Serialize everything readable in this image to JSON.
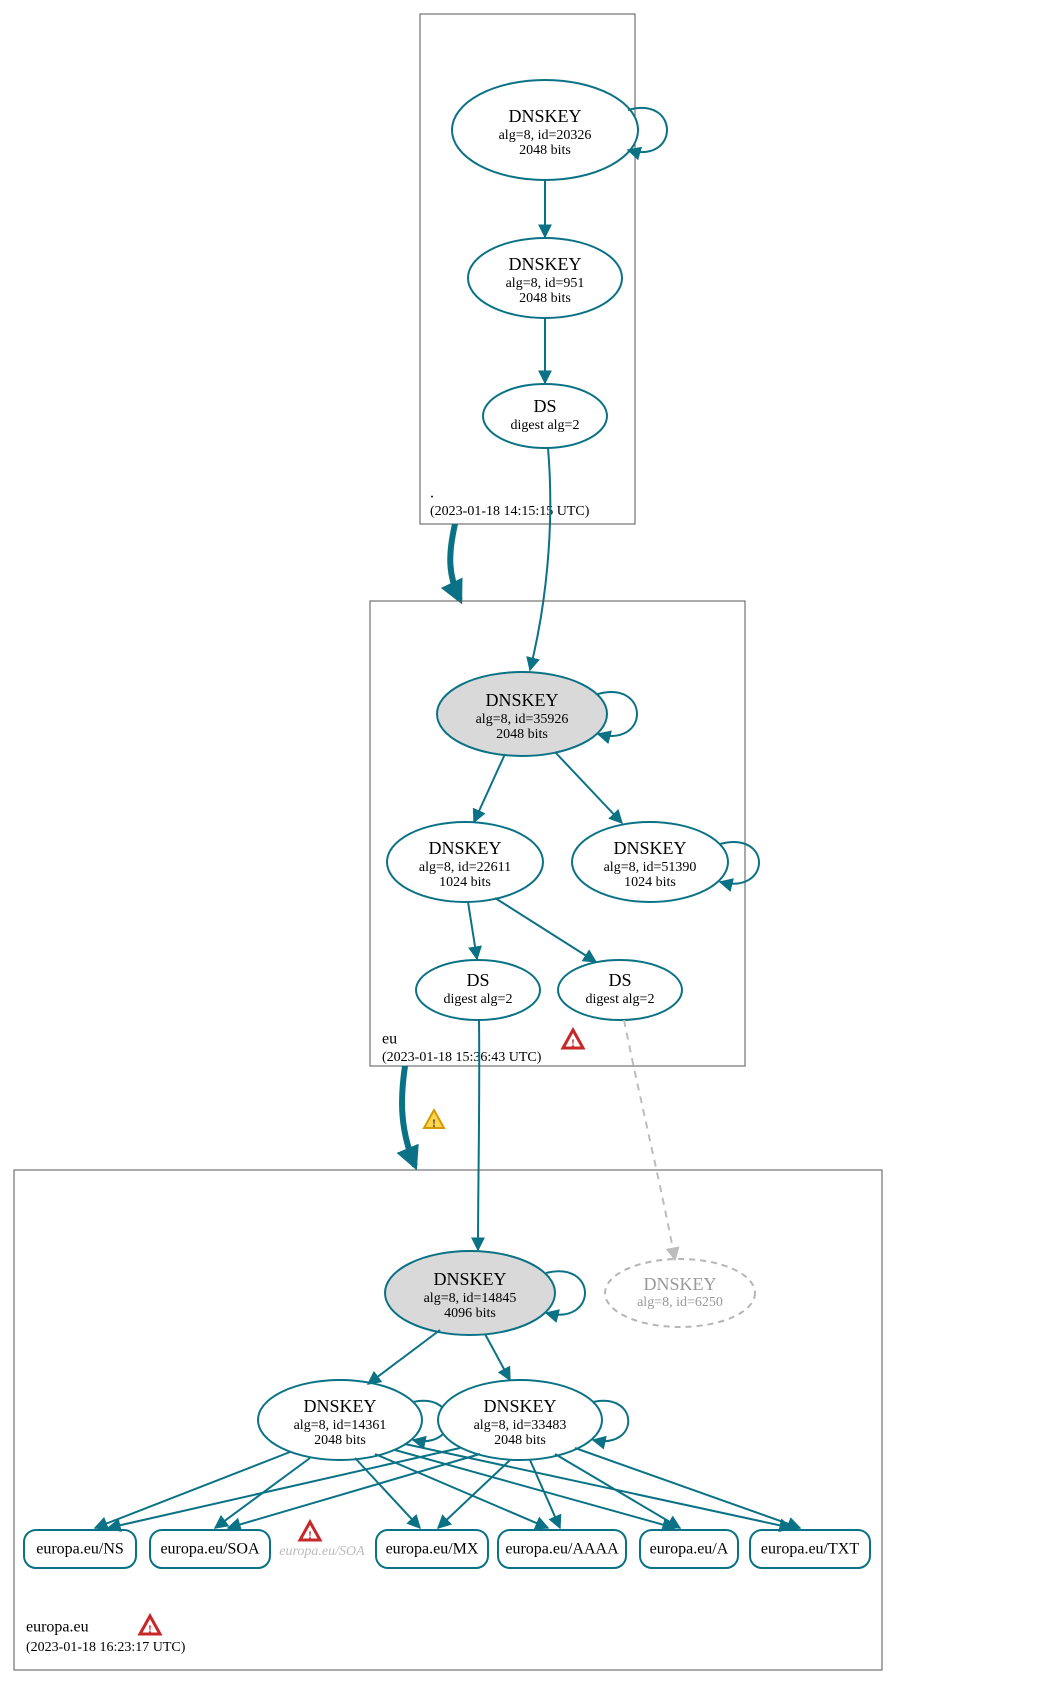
{
  "zones": {
    "root": {
      "label": ".",
      "timestamp": "(2023-01-18 14:15:15 UTC)",
      "nodes": {
        "ksk": {
          "title": "DNSKEY",
          "line1": "alg=8, id=20326",
          "line2": "2048 bits"
        },
        "zsk": {
          "title": "DNSKEY",
          "line1": "alg=8, id=951",
          "line2": "2048 bits"
        },
        "ds": {
          "title": "DS",
          "line1": "digest alg=2"
        }
      }
    },
    "eu": {
      "label": "eu",
      "timestamp": "(2023-01-18 15:36:43 UTC)",
      "nodes": {
        "ksk": {
          "title": "DNSKEY",
          "line1": "alg=8, id=35926",
          "line2": "2048 bits"
        },
        "zsk1": {
          "title": "DNSKEY",
          "line1": "alg=8, id=22611",
          "line2": "1024 bits"
        },
        "zsk2": {
          "title": "DNSKEY",
          "line1": "alg=8, id=51390",
          "line2": "1024 bits"
        },
        "ds1": {
          "title": "DS",
          "line1": "digest alg=2"
        },
        "ds2": {
          "title": "DS",
          "line1": "digest alg=2"
        }
      }
    },
    "europa": {
      "label": "europa.eu",
      "timestamp": "(2023-01-18 16:23:17 UTC)",
      "nodes": {
        "ksk": {
          "title": "DNSKEY",
          "line1": "alg=8, id=14845",
          "line2": "4096 bits"
        },
        "ghost": {
          "title": "DNSKEY",
          "line1": "alg=8, id=6250"
        },
        "zsk1": {
          "title": "DNSKEY",
          "line1": "alg=8, id=14361",
          "line2": "2048 bits"
        },
        "zsk2": {
          "title": "DNSKEY",
          "line1": "alg=8, id=33483",
          "line2": "2048 bits"
        }
      },
      "records": {
        "ns": "europa.eu/NS",
        "soa": "europa.eu/SOA",
        "soa2": "europa.eu/SOA",
        "mx": "europa.eu/MX",
        "aaaa": "europa.eu/AAAA",
        "a": "europa.eu/A",
        "txt": "europa.eu/TXT"
      }
    }
  }
}
